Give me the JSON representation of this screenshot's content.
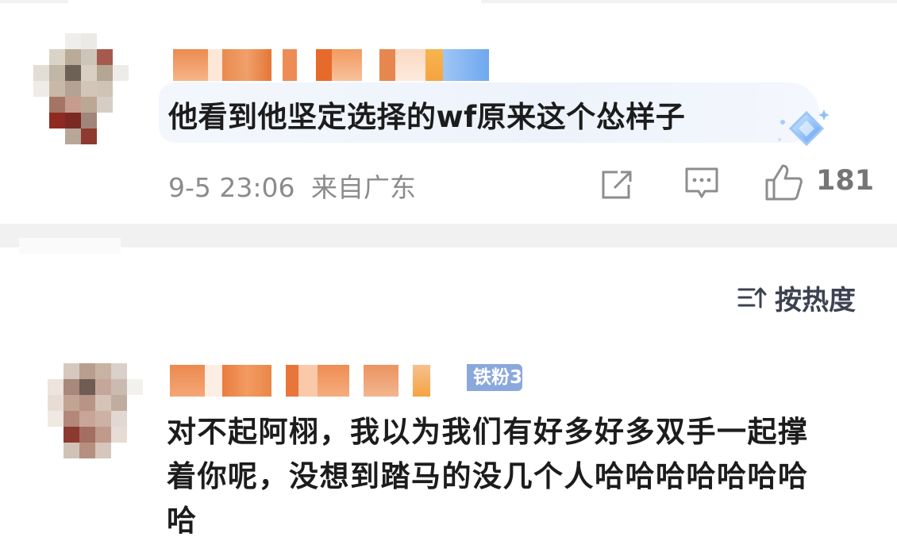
{
  "comments": [
    {
      "text": "他看到他坚定选择的wf原来这个怂样子",
      "date": "9-5 23:06",
      "location": "来自广东",
      "like_count": "181",
      "icons": [
        "share-icon",
        "reply-icon",
        "like-icon",
        "badge-diamond-icon"
      ]
    },
    {
      "fan_badge": "铁粉3",
      "text_lines": [
        "对不起阿栩，我以为我们有好多好多双手一起撑",
        "着你呢，没想到踏马的没几个人哈哈哈哈哈哈哈",
        "哈"
      ]
    }
  ],
  "sort": {
    "label": "按热度",
    "icon": "sort-icon"
  },
  "colors": {
    "accent_fan": "#8aa8dc",
    "text_primary": "#1c1c1c",
    "text_meta": "#8b8b8b",
    "username_orange": "#e8773a"
  }
}
